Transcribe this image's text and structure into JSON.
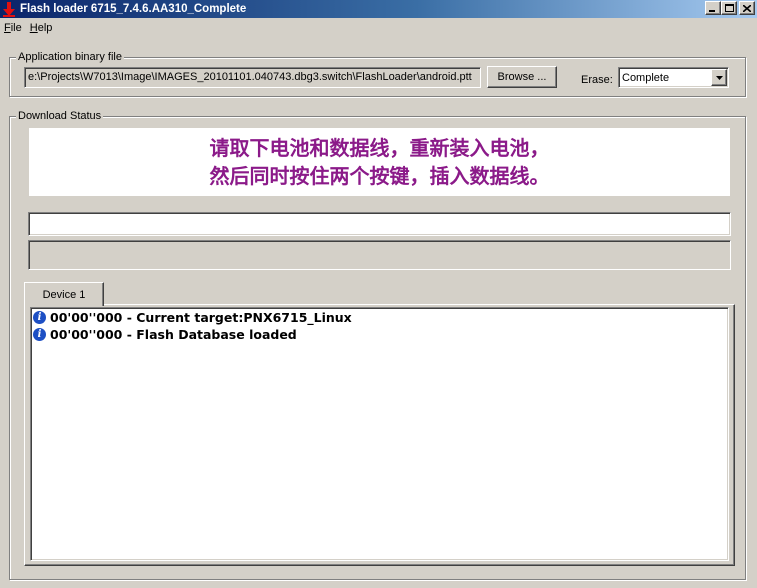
{
  "window": {
    "title": "Flash loader 6715_7.4.6.AA310_Complete",
    "controls": [
      "minimize",
      "maximize",
      "close"
    ]
  },
  "menu": {
    "items": [
      {
        "label": "File",
        "mnemonic": "F"
      },
      {
        "label": "Help",
        "mnemonic": "H"
      }
    ]
  },
  "app_binary": {
    "group_label": "Application binary file",
    "path": "e:\\Projects\\W7013\\Image\\IMAGES_20101101.040743.dbg3.switch\\FlashLoader\\android.ptt",
    "browse_label": "Browse ...",
    "erase_label": "Erase:",
    "erase_value": "Complete"
  },
  "download_status": {
    "group_label": "Download Status",
    "instruction_line1": "请取下电池和数据线，重新装入电池，",
    "instruction_line2": "然后同时按住两个按键，插入数据线。",
    "instruction_color": "#8b1a89"
  },
  "tabs": [
    {
      "label": "Device 1",
      "active": true
    }
  ],
  "log": [
    {
      "icon": "info-icon",
      "text": "00'00''000 - Current target:PNX6715_Linux"
    },
    {
      "icon": "info-icon",
      "text": "00'00''000 - Flash Database loaded"
    }
  ]
}
